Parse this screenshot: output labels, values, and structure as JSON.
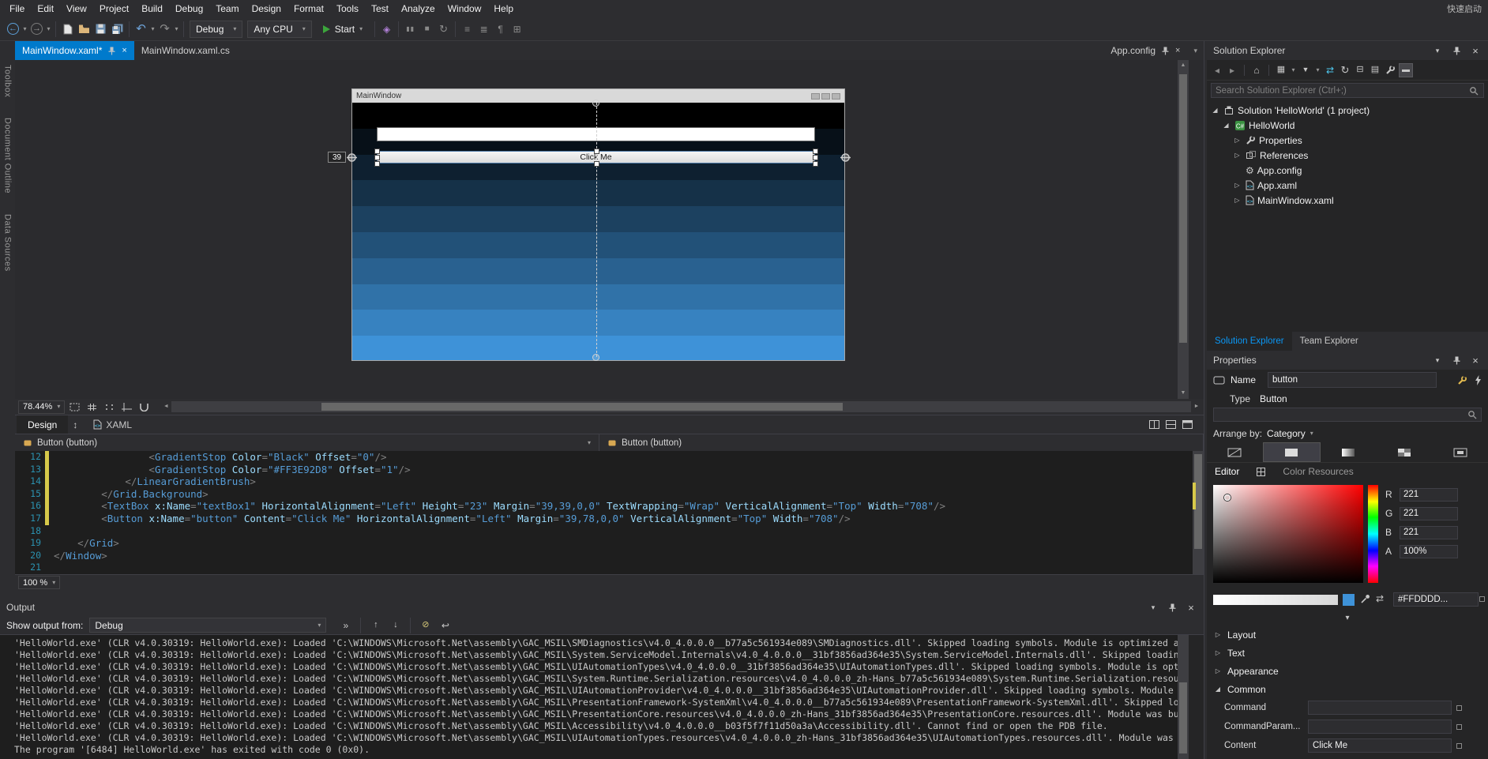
{
  "colors": {
    "accent": "#007acc",
    "editor_bg": "#1e1e1e",
    "panel_bg": "#252526",
    "chrome_bg": "#2d2d30",
    "gradient_top": "#000000",
    "gradient_bottom": "#3e92d8",
    "selected_color": "#dddddd",
    "change_bar": "#d7c94a"
  },
  "menubar": {
    "items": [
      "File",
      "Edit",
      "View",
      "Project",
      "Build",
      "Debug",
      "Team",
      "Design",
      "Format",
      "Tools",
      "Test",
      "Analyze",
      "Window",
      "Help"
    ],
    "quick_launch": "快速启动"
  },
  "toolbar": {
    "debug_target": "Debug",
    "platform": "Any CPU",
    "start_label": "Start",
    "icons_file": [
      "new-file-icon",
      "open-file-icon",
      "save-icon",
      "save-all-icon"
    ],
    "icons_after_start": [
      "application-insights-icon",
      "break-all-icon",
      "stop-debug-icon",
      "restart-icon",
      "comment-icon",
      "uncomment-icon",
      "format-document-icon",
      "format-selection-icon"
    ]
  },
  "tabs": {
    "active": "MainWindow.xaml*",
    "inactive": "MainWindow.xaml.cs",
    "preview": "App.config"
  },
  "side_strip": [
    "Toolbox",
    "Document Outline",
    "Data Sources"
  ],
  "designer": {
    "window_title": "MainWindow",
    "button_label": "Click Me",
    "margin_badge": "39",
    "zoom_value": "78.44%",
    "design_tab": "Design",
    "xaml_tab": "XAML",
    "breadcrumb_left": "Button (button)",
    "breadcrumb_right": "Button (button)",
    "zoom_icons": [
      "zoom-fit-icon",
      "show-snap-grid-icon",
      "snap-to-gridlines-icon",
      "show-guides-icon",
      "snap-to-guides-icon"
    ],
    "pane_icons": [
      "split-vertical-icon",
      "split-horizontal-icon",
      "expand-pane-icon"
    ]
  },
  "editor": {
    "zoom_value": "100 %",
    "lines": [
      {
        "n": 12,
        "chg": true,
        "t": [
          [
            "t",
            "                "
          ],
          [
            "d",
            "<"
          ],
          [
            "e",
            "GradientStop"
          ],
          [
            "t",
            " "
          ],
          [
            "a",
            "Color"
          ],
          [
            "d",
            "="
          ],
          [
            "v",
            "\"Black\""
          ],
          [
            "t",
            " "
          ],
          [
            "a",
            "Offset"
          ],
          [
            "d",
            "="
          ],
          [
            "v",
            "\"0\""
          ],
          [
            "d",
            "/>"
          ]
        ]
      },
      {
        "n": 13,
        "chg": true,
        "t": [
          [
            "t",
            "                "
          ],
          [
            "d",
            "<"
          ],
          [
            "e",
            "GradientStop"
          ],
          [
            "t",
            " "
          ],
          [
            "a",
            "Color"
          ],
          [
            "d",
            "="
          ],
          [
            "v",
            "\"#FF3E92D8\""
          ],
          [
            "t",
            " "
          ],
          [
            "a",
            "Offset"
          ],
          [
            "d",
            "="
          ],
          [
            "v",
            "\"1\""
          ],
          [
            "d",
            "/>"
          ]
        ]
      },
      {
        "n": 14,
        "chg": true,
        "t": [
          [
            "t",
            "            "
          ],
          [
            "d",
            "</"
          ],
          [
            "e",
            "LinearGradientBrush"
          ],
          [
            "d",
            ">"
          ]
        ]
      },
      {
        "n": 15,
        "chg": true,
        "t": [
          [
            "t",
            "        "
          ],
          [
            "d",
            "</"
          ],
          [
            "e",
            "Grid.Background"
          ],
          [
            "d",
            ">"
          ]
        ]
      },
      {
        "n": 16,
        "chg": true,
        "t": [
          [
            "t",
            "        "
          ],
          [
            "d",
            "<"
          ],
          [
            "e",
            "TextBox"
          ],
          [
            "t",
            " "
          ],
          [
            "a",
            "x:Name"
          ],
          [
            "d",
            "="
          ],
          [
            "v",
            "\"textBox1\""
          ],
          [
            "t",
            " "
          ],
          [
            "a",
            "HorizontalAlignment"
          ],
          [
            "d",
            "="
          ],
          [
            "v",
            "\"Left\""
          ],
          [
            "t",
            " "
          ],
          [
            "a",
            "Height"
          ],
          [
            "d",
            "="
          ],
          [
            "v",
            "\"23\""
          ],
          [
            "t",
            " "
          ],
          [
            "a",
            "Margin"
          ],
          [
            "d",
            "="
          ],
          [
            "v",
            "\"39,39,0,0\""
          ],
          [
            "t",
            " "
          ],
          [
            "a",
            "TextWrapping"
          ],
          [
            "d",
            "="
          ],
          [
            "v",
            "\"Wrap\""
          ],
          [
            "t",
            " "
          ],
          [
            "a",
            "VerticalAlignment"
          ],
          [
            "d",
            "="
          ],
          [
            "v",
            "\"Top\""
          ],
          [
            "t",
            " "
          ],
          [
            "a",
            "Width"
          ],
          [
            "d",
            "="
          ],
          [
            "v",
            "\"708\""
          ],
          [
            "d",
            "/>"
          ]
        ]
      },
      {
        "n": 17,
        "chg": true,
        "t": [
          [
            "t",
            "        "
          ],
          [
            "d",
            "<"
          ],
          [
            "e",
            "Button"
          ],
          [
            "t",
            " "
          ],
          [
            "a",
            "x:Name"
          ],
          [
            "d",
            "="
          ],
          [
            "v",
            "\"button\""
          ],
          [
            "t",
            " "
          ],
          [
            "a",
            "Content"
          ],
          [
            "d",
            "="
          ],
          [
            "v",
            "\"Click Me\""
          ],
          [
            "t",
            " "
          ],
          [
            "a",
            "HorizontalAlignment"
          ],
          [
            "d",
            "="
          ],
          [
            "v",
            "\"Left\""
          ],
          [
            "t",
            " "
          ],
          [
            "a",
            "Margin"
          ],
          [
            "d",
            "="
          ],
          [
            "v",
            "\"39,78,0,0\""
          ],
          [
            "t",
            " "
          ],
          [
            "a",
            "VerticalAlignment"
          ],
          [
            "d",
            "="
          ],
          [
            "v",
            "\"Top\""
          ],
          [
            "t",
            " "
          ],
          [
            "a",
            "Width"
          ],
          [
            "d",
            "="
          ],
          [
            "v",
            "\"708\""
          ],
          [
            "d",
            "/>"
          ]
        ]
      },
      {
        "n": 18,
        "chg": false,
        "t": []
      },
      {
        "n": 19,
        "chg": false,
        "t": [
          [
            "t",
            "    "
          ],
          [
            "d",
            "</"
          ],
          [
            "e",
            "Grid"
          ],
          [
            "d",
            ">"
          ]
        ]
      },
      {
        "n": 20,
        "chg": false,
        "t": [
          [
            "d",
            "</"
          ],
          [
            "e",
            "Window"
          ],
          [
            "d",
            ">"
          ]
        ]
      },
      {
        "n": 21,
        "chg": false,
        "t": []
      }
    ]
  },
  "output": {
    "title": "Output",
    "source_label": "Show output from:",
    "source_value": "Debug",
    "toolbar_icons": [
      "goto-message-icon",
      "prev-message-icon",
      "next-message-icon",
      "clear-all-icon",
      "toggle-word-wrap-icon"
    ],
    "lines": [
      "'HelloWorld.exe' (CLR v4.0.30319: HelloWorld.exe): Loaded 'C:\\WINDOWS\\Microsoft.Net\\assembly\\GAC_MSIL\\SMDiagnostics\\v4.0_4.0.0.0__b77a5c561934e089\\SMDiagnostics.dll'. Skipped loading symbols. Module is optimized and the debugger option 'Just My Code' is enabled.",
      "'HelloWorld.exe' (CLR v4.0.30319: HelloWorld.exe): Loaded 'C:\\WINDOWS\\Microsoft.Net\\assembly\\GAC_MSIL\\System.ServiceModel.Internals\\v4.0_4.0.0.0__31bf3856ad364e35\\System.ServiceModel.Internals.dll'. Skipped loading symbols. Module is optimized and the debugger option 'Just My Code' is enabled.",
      "'HelloWorld.exe' (CLR v4.0.30319: HelloWorld.exe): Loaded 'C:\\WINDOWS\\Microsoft.Net\\assembly\\GAC_MSIL\\UIAutomationTypes\\v4.0_4.0.0.0__31bf3856ad364e35\\UIAutomationTypes.dll'. Skipped loading symbols. Module is optimized and the debugger option 'Just My Code' is enabled.",
      "'HelloWorld.exe' (CLR v4.0.30319: HelloWorld.exe): Loaded 'C:\\WINDOWS\\Microsoft.Net\\assembly\\GAC_MSIL\\System.Runtime.Serialization.resources\\v4.0_4.0.0.0_zh-Hans_b77a5c561934e089\\System.Runtime.Serialization.resources.dll'. Module was built without symbols.",
      "'HelloWorld.exe' (CLR v4.0.30319: HelloWorld.exe): Loaded 'C:\\WINDOWS\\Microsoft.Net\\assembly\\GAC_MSIL\\UIAutomationProvider\\v4.0_4.0.0.0__31bf3856ad364e35\\UIAutomationProvider.dll'. Skipped loading symbols. Module is optimized and the debugger option 'Just My Code' is enabled.",
      "'HelloWorld.exe' (CLR v4.0.30319: HelloWorld.exe): Loaded 'C:\\WINDOWS\\Microsoft.Net\\assembly\\GAC_MSIL\\PresentationFramework-SystemXml\\v4.0_4.0.0.0__b77a5c561934e089\\PresentationFramework-SystemXml.dll'. Skipped loading symbols. Module is optimized and the debugger option 'Just My Code' is enabled.",
      "'HelloWorld.exe' (CLR v4.0.30319: HelloWorld.exe): Loaded 'C:\\WINDOWS\\Microsoft.Net\\assembly\\GAC_MSIL\\PresentationCore.resources\\v4.0_4.0.0.0_zh-Hans_31bf3856ad364e35\\PresentationCore.resources.dll'. Module was built without symbols.",
      "'HelloWorld.exe' (CLR v4.0.30319: HelloWorld.exe): Loaded 'C:\\WINDOWS\\Microsoft.Net\\assembly\\GAC_MSIL\\Accessibility\\v4.0_4.0.0.0__b03f5f7f11d50a3a\\Accessibility.dll'. Cannot find or open the PDB file.",
      "'HelloWorld.exe' (CLR v4.0.30319: HelloWorld.exe): Loaded 'C:\\WINDOWS\\Microsoft.Net\\assembly\\GAC_MSIL\\UIAutomationTypes.resources\\v4.0_4.0.0.0_zh-Hans_31bf3856ad364e35\\UIAutomationTypes.resources.dll'. Module was built without symbols.",
      "The program '[6484] HelloWorld.exe' has exited with code 0 (0x0)."
    ]
  },
  "solution_explorer": {
    "title": "Solution Explorer",
    "search_placeholder": "Search Solution Explorer (Ctrl+;)",
    "toolbar_icons": [
      "nav-back-icon",
      "nav-forward-icon",
      "home-icon",
      "switch-views-icon",
      "pending-changes-filter-icon",
      "sync-with-active-document-icon",
      "refresh-icon",
      "collapse-all-icon",
      "show-all-files-icon",
      "properties-icon",
      "preview-selected-items-icon"
    ],
    "tree": [
      {
        "label": "Solution 'HelloWorld' (1 project)",
        "icon": "solution-icon",
        "indent": 0,
        "state": "expanded"
      },
      {
        "label": "HelloWorld",
        "icon": "csharp-project-icon",
        "indent": 1,
        "state": "expanded"
      },
      {
        "label": "Properties",
        "icon": "properties-icon",
        "indent": 2,
        "state": "collapsed"
      },
      {
        "label": "References",
        "icon": "references-icon",
        "indent": 2,
        "state": "collapsed"
      },
      {
        "label": "App.config",
        "icon": "config-file-icon",
        "indent": 2,
        "state": "none"
      },
      {
        "label": "App.xaml",
        "icon": "xaml-file-icon",
        "indent": 2,
        "state": "collapsed"
      },
      {
        "label": "MainWindow.xaml",
        "icon": "xaml-file-icon",
        "indent": 2,
        "state": "collapsed"
      }
    ],
    "bottom_tabs": [
      {
        "label": "Solution Explorer",
        "active": true
      },
      {
        "label": "Team Explorer",
        "active": false
      }
    ]
  },
  "properties": {
    "title": "Properties",
    "name_label": "Name",
    "name_value": "button",
    "type_label": "Type",
    "type_value": "Button",
    "arrange_label": "Arrange by:",
    "arrange_value": "Category",
    "brush_tabs": [
      "null-brush-icon",
      "solid-color-brush-icon",
      "gradient-brush-icon",
      "tile-brush-icon",
      "brush-resource-icon"
    ],
    "brush_selected_index": 1,
    "subtabs": {
      "editor": "Editor",
      "resources": "Color Resources"
    },
    "channels": [
      {
        "label": "R",
        "value": "221"
      },
      {
        "label": "G",
        "value": "221"
      },
      {
        "label": "B",
        "value": "221"
      },
      {
        "label": "A",
        "value": "100%"
      }
    ],
    "hex_value": "#FFDDDD...",
    "swatch_color": "#dddddd",
    "secondary_swatch_color": "#3e92d8",
    "collapsed_categories": [
      "Layout",
      "Text",
      "Appearance"
    ],
    "expanded_category": "Common",
    "common_rows": [
      {
        "label": "Command",
        "value": ""
      },
      {
        "label": "CommandParam...",
        "value": ""
      },
      {
        "label": "Content",
        "value": "Click Me"
      }
    ]
  }
}
